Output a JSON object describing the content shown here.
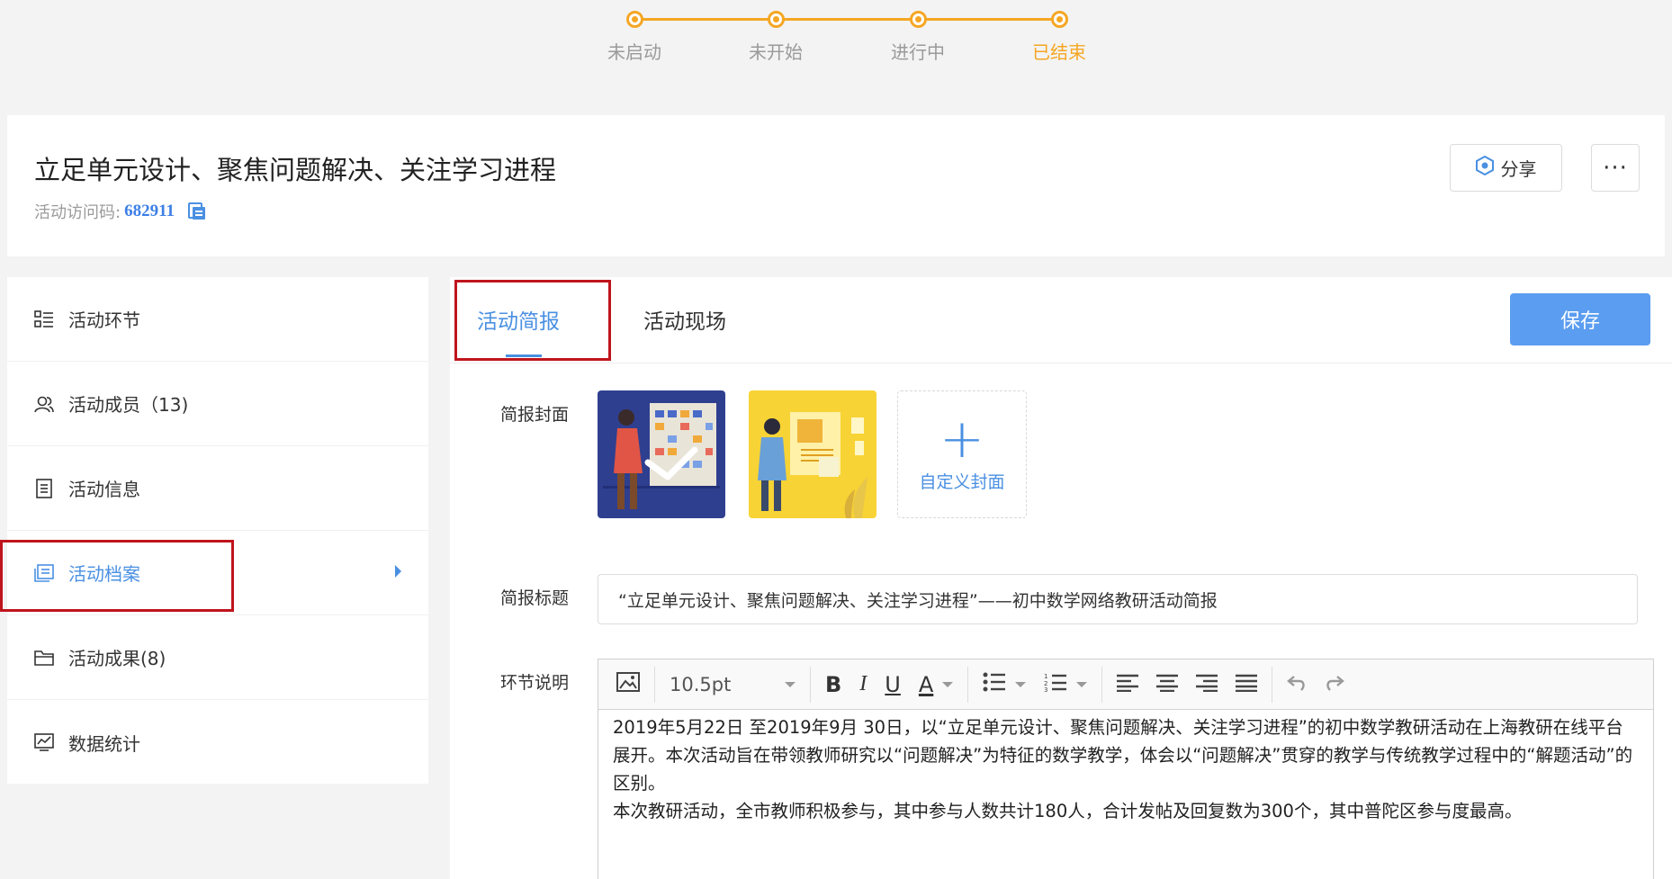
{
  "steps": [
    {
      "label": "未启动",
      "done": false
    },
    {
      "label": "未开始",
      "done": false
    },
    {
      "label": "进行中",
      "done": false
    },
    {
      "label": "已结束",
      "done": true
    }
  ],
  "header": {
    "title": "立足单元设计、聚焦问题解决、关注学习进程",
    "code_label": "活动访问码:",
    "code_value": "682911",
    "share_label": "分享",
    "more_label": "···"
  },
  "sidebar": {
    "items": [
      {
        "label": "活动环节",
        "icon": "list-icon"
      },
      {
        "label": "活动成员（13)",
        "icon": "members-icon"
      },
      {
        "label": "活动信息",
        "icon": "document-icon"
      },
      {
        "label": "活动档案",
        "icon": "archive-icon",
        "active": true
      },
      {
        "label": "活动成果(8)",
        "icon": "folder-icon"
      },
      {
        "label": "数据统计",
        "icon": "chart-icon"
      }
    ]
  },
  "tabs": [
    {
      "label": "活动简报",
      "active": true
    },
    {
      "label": "活动现场",
      "active": false
    }
  ],
  "save_label": "保存",
  "form": {
    "cover_label": "简报封面",
    "custom_cover_label": "自定义封面",
    "title_label": "简报标题",
    "title_value": "“立足单元设计、聚焦问题解决、关注学习进程”——初中数学网络教研活动简报",
    "desc_label": "环节说明"
  },
  "editor": {
    "font_size": "10.5pt",
    "bold": "B",
    "italic": "I",
    "underline": "U",
    "font_color": "A",
    "paragraphs": [
      "2019年5月22日 至2019年9月 30日，以“立足单元设计、聚焦问题解决、关注学习进程”的初中数学教研活动在上海教研在线平台展开。本次活动旨在带领教师研究以“问题解决”为特征的数学教学，体会以“问题解决”贯穿的教学与传统教学过程中的“解题活动”的区别。",
      "本次教研活动，全市教师积极参与，其中参与人数共计180人，合计发帖及回复数为300个，其中普陀区参与度最高。"
    ]
  },
  "colors": {
    "accent": "#4a90e2",
    "step": "#f5a623",
    "highlight_box": "#c0141c"
  }
}
